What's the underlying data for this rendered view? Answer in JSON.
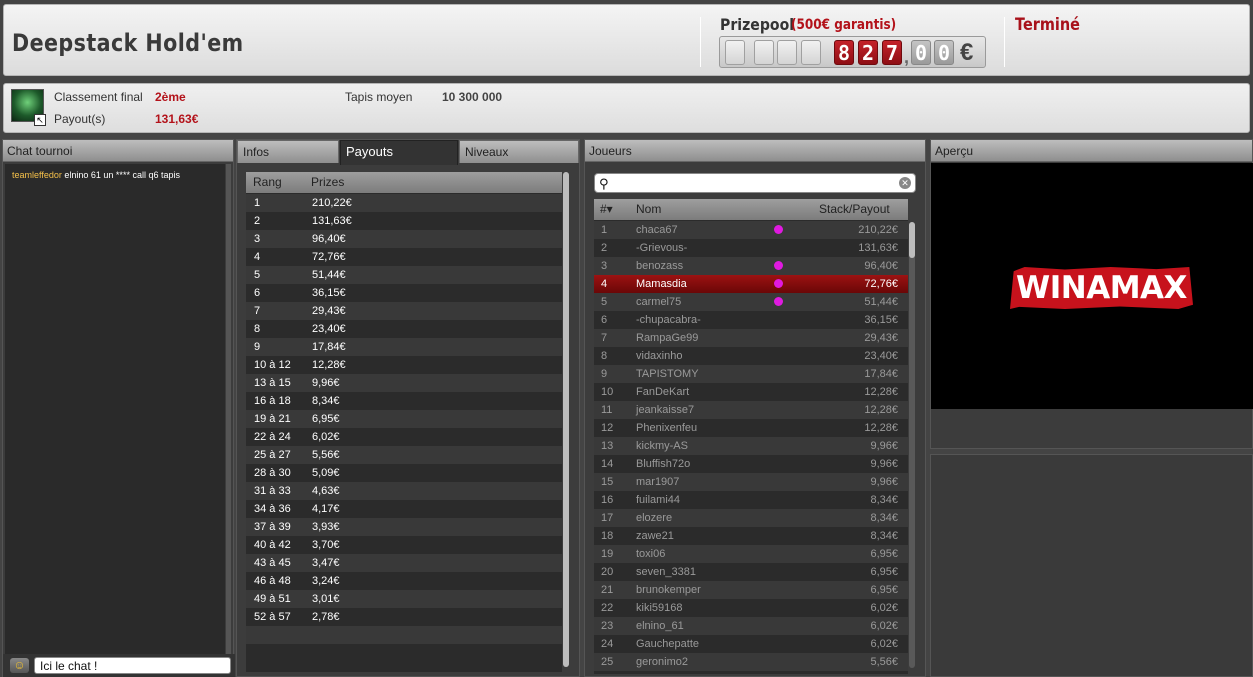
{
  "header": {
    "title": "Deepstack Hold'em",
    "prizepool_label": "Prizepool",
    "prizepool_guarantee": "(500€ garantis)",
    "counter_digits": [
      "",
      "",
      "",
      "",
      "8",
      "2",
      "7",
      "0",
      "0"
    ],
    "counter_separator": ",",
    "counter_currency": "€",
    "status": "Terminé"
  },
  "info": {
    "rank_label": "Classement final",
    "rank_value": "2ème",
    "payout_label": "Payout(s)",
    "payout_value": "131,63€",
    "avg_stack_label": "Tapis moyen",
    "avg_stack_value": "10 300 000"
  },
  "chat": {
    "title": "Chat tournoi",
    "messages": [
      {
        "user": "teamleffedor",
        "text": "elnino 61 un **** call q6 tapis"
      }
    ],
    "input_value": "Ici le chat !"
  },
  "tabs": {
    "infos": "Infos",
    "payouts": "Payouts",
    "niveaux": "Niveaux"
  },
  "payouts": {
    "headers": {
      "rank": "Rang",
      "prize": "Prizes"
    },
    "rows": [
      [
        "1",
        "210,22€"
      ],
      [
        "2",
        "131,63€"
      ],
      [
        "3",
        "96,40€"
      ],
      [
        "4",
        "72,76€"
      ],
      [
        "5",
        "51,44€"
      ],
      [
        "6",
        "36,15€"
      ],
      [
        "7",
        "29,43€"
      ],
      [
        "8",
        "23,40€"
      ],
      [
        "9",
        "17,84€"
      ],
      [
        "10 à 12",
        "12,28€"
      ],
      [
        "13 à 15",
        "9,96€"
      ],
      [
        "16 à 18",
        "8,34€"
      ],
      [
        "19 à 21",
        "6,95€"
      ],
      [
        "22 à 24",
        "6,02€"
      ],
      [
        "25 à 27",
        "5,56€"
      ],
      [
        "28 à 30",
        "5,09€"
      ],
      [
        "31 à 33",
        "4,63€"
      ],
      [
        "34 à 36",
        "4,17€"
      ],
      [
        "37 à 39",
        "3,93€"
      ],
      [
        "40 à 42",
        "3,70€"
      ],
      [
        "43 à 45",
        "3,47€"
      ],
      [
        "46 à 48",
        "3,24€"
      ],
      [
        "49 à 51",
        "3,01€"
      ],
      [
        "52 à 57",
        "2,78€"
      ]
    ]
  },
  "players": {
    "title": "Joueurs",
    "search_value": "",
    "headers": {
      "num": "#▾",
      "name": "Nom",
      "stack": "Stack/Payout"
    },
    "rows": [
      [
        "1",
        "chaca67",
        "210,22€",
        true
      ],
      [
        "2",
        "-Grievous-",
        "131,63€",
        false
      ],
      [
        "3",
        "benozass",
        "96,40€",
        true
      ],
      [
        "4",
        "Mamasdia",
        "72,76€",
        true
      ],
      [
        "5",
        "carmel75",
        "51,44€",
        true
      ],
      [
        "6",
        "-chupacabra-",
        "36,15€",
        false
      ],
      [
        "7",
        "RampaGe99",
        "29,43€",
        false
      ],
      [
        "8",
        "vidaxinho",
        "23,40€",
        false
      ],
      [
        "9",
        "TAPISTOMY",
        "17,84€",
        false
      ],
      [
        "10",
        "FanDeKart",
        "12,28€",
        false
      ],
      [
        "11",
        "jeankaisse7",
        "12,28€",
        false
      ],
      [
        "12",
        "Phenixenfeu",
        "12,28€",
        false
      ],
      [
        "13",
        "kickmy-AS",
        "9,96€",
        false
      ],
      [
        "14",
        "Bluffish72o",
        "9,96€",
        false
      ],
      [
        "15",
        "mar1907",
        "9,96€",
        false
      ],
      [
        "16",
        "fuilami44",
        "8,34€",
        false
      ],
      [
        "17",
        "elozere",
        "8,34€",
        false
      ],
      [
        "18",
        "zawe21",
        "8,34€",
        false
      ],
      [
        "19",
        "toxi06",
        "6,95€",
        false
      ],
      [
        "20",
        "seven_3381",
        "6,95€",
        false
      ],
      [
        "21",
        "brunokemper",
        "6,95€",
        false
      ],
      [
        "22",
        "kiki59168",
        "6,02€",
        false
      ],
      [
        "23",
        "elnino_61",
        "6,02€",
        false
      ],
      [
        "24",
        "Gauchepatte",
        "6,02€",
        false
      ],
      [
        "25",
        "geronimo2",
        "5,56€",
        false
      ]
    ],
    "selected_index": 3
  },
  "apercu": {
    "title": "Aperçu",
    "logo_text": "WINAMAX"
  }
}
